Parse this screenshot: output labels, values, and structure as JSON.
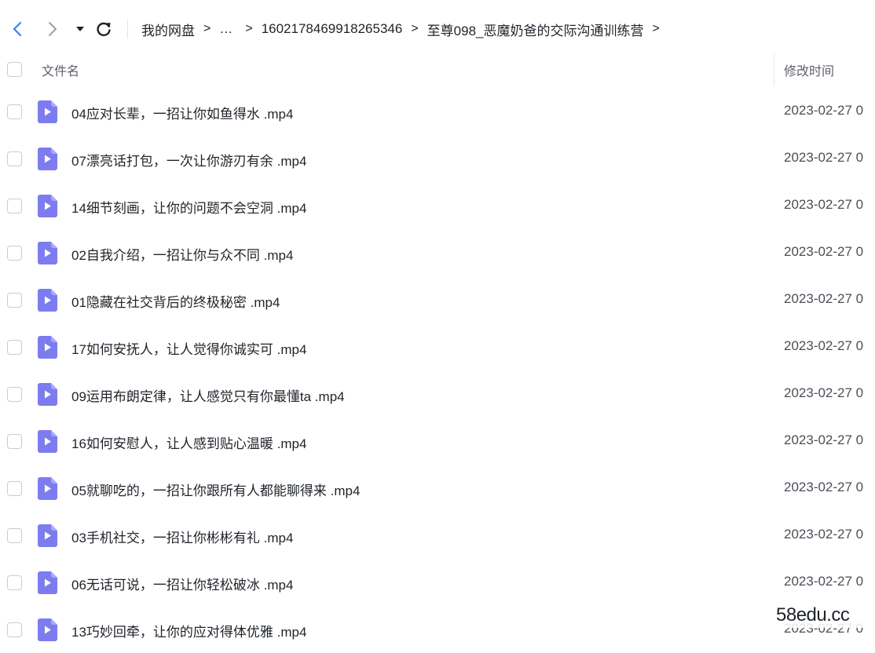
{
  "toolbar": {
    "back_icon": "chevron-left-icon",
    "forward_icon": "chevron-right-icon",
    "dropdown_icon": "caret-down-icon",
    "refresh_icon": "refresh-icon",
    "accent_color": "#3b7cff"
  },
  "breadcrumb": {
    "items": [
      "我的网盘",
      "…",
      "1602178469918265346",
      "至尊098_恶魔奶爸的交际沟通训练营"
    ],
    "separator": ">"
  },
  "columns": {
    "name": "文件名",
    "modified": "修改时间"
  },
  "files": [
    {
      "name": "04应对长辈，一招让你如鱼得水 .mp4",
      "modified": "2023-02-27 0"
    },
    {
      "name": "07漂亮话打包，一次让你游刃有余 .mp4",
      "modified": "2023-02-27 0"
    },
    {
      "name": "14细节刻画，让你的问题不会空洞 .mp4",
      "modified": "2023-02-27 0"
    },
    {
      "name": "02自我介绍，一招让你与众不同 .mp4",
      "modified": "2023-02-27 0"
    },
    {
      "name": "01隐藏在社交背后的终极秘密 .mp4",
      "modified": "2023-02-27 0"
    },
    {
      "name": "17如何安抚人，让人觉得你诚实可 .mp4",
      "modified": "2023-02-27 0"
    },
    {
      "name": "09运用布朗定律，让人感觉只有你最懂ta .mp4",
      "modified": "2023-02-27 0"
    },
    {
      "name": "16如何安慰人，让人感到贴心温暖 .mp4",
      "modified": "2023-02-27 0"
    },
    {
      "name": "05就聊吃的，一招让你跟所有人都能聊得来 .mp4",
      "modified": "2023-02-27 0"
    },
    {
      "name": "03手机社交，一招让你彬彬有礼 .mp4",
      "modified": "2023-02-27 0"
    },
    {
      "name": "06无话可说，一招让你轻松破冰 .mp4",
      "modified": "2023-02-27 0"
    },
    {
      "name": "13巧妙回牵，让你的应对得体优雅 .mp4",
      "modified": "2023-02-27 0"
    }
  ],
  "file_icon": {
    "name": "video-file-icon",
    "color": "#7c7cf0"
  },
  "watermark": "58edu.cc"
}
